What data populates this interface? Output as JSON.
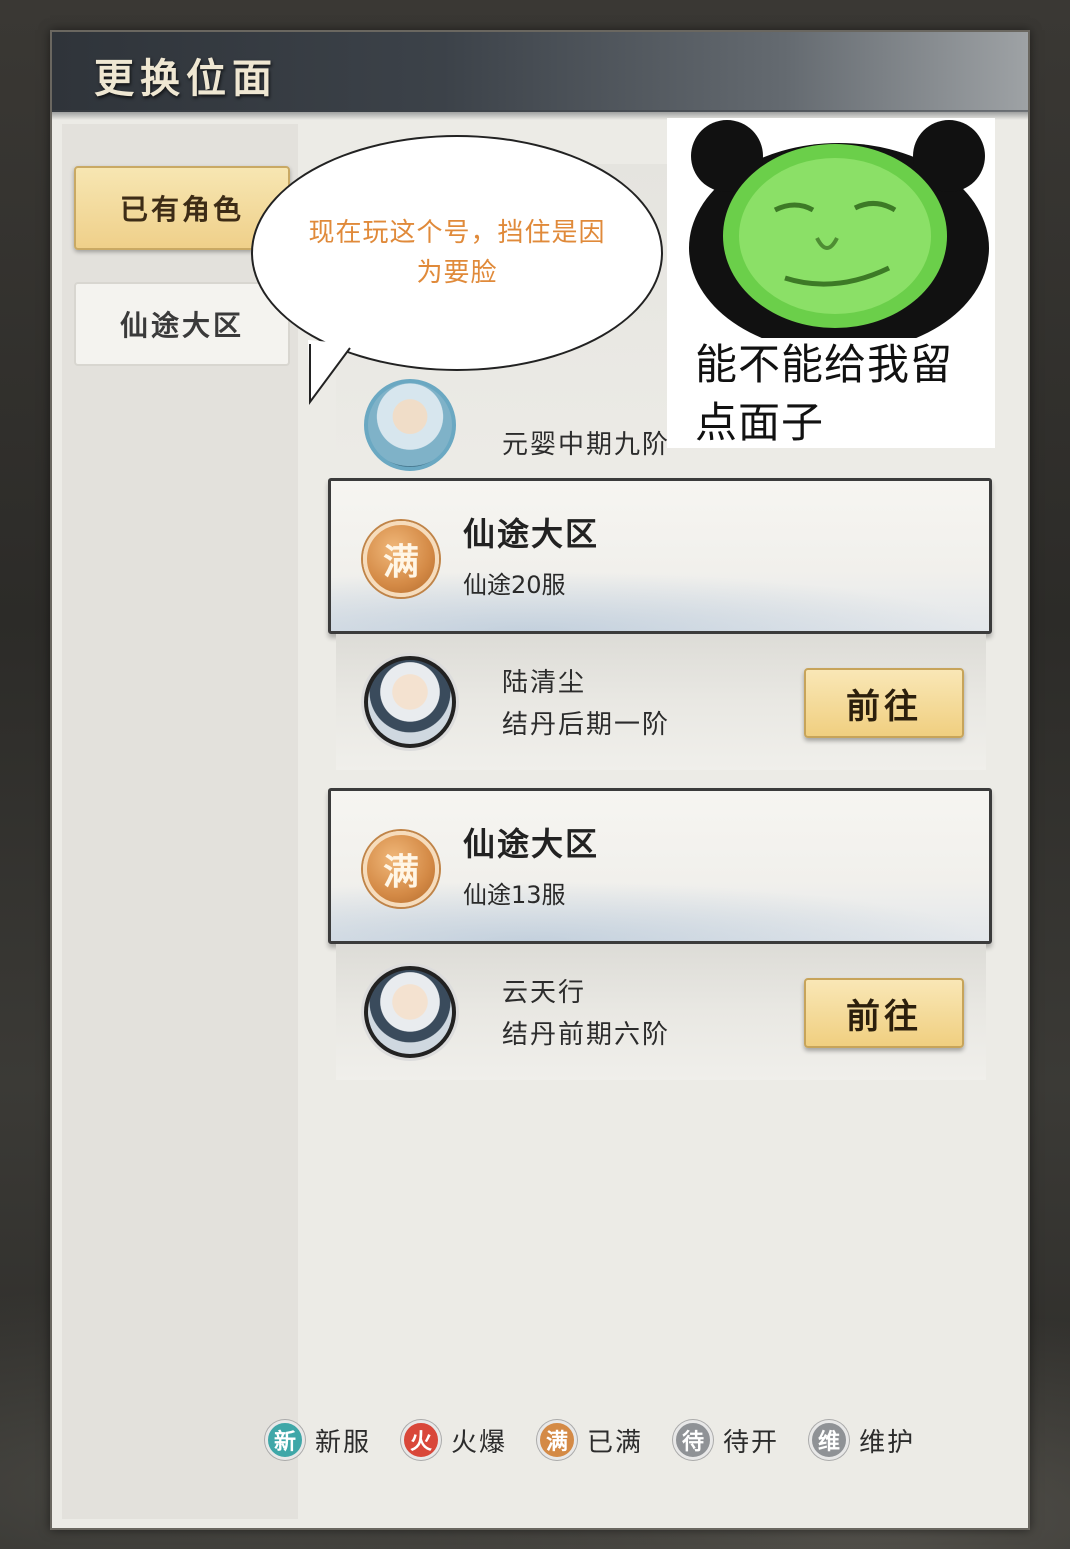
{
  "window": {
    "title": "更换位面"
  },
  "sidebar": {
    "tabs": [
      {
        "label": "已有角色",
        "active": true
      },
      {
        "label": "仙途大区",
        "active": false
      }
    ]
  },
  "partial_entry": {
    "level": "元婴中期九阶"
  },
  "servers": [
    {
      "badge": "满",
      "region": "仙途大区",
      "server": "仙途20服",
      "character": {
        "name": "陆清尘",
        "level": "结丹后期一阶"
      },
      "action_label": "前往"
    },
    {
      "badge": "满",
      "region": "仙途大区",
      "server": "仙途13服",
      "character": {
        "name": "云天行",
        "level": "结丹前期六阶"
      },
      "action_label": "前往"
    }
  ],
  "legend": [
    {
      "glyph": "新",
      "label": "新服",
      "color": "#3fa7a8"
    },
    {
      "glyph": "火",
      "label": "火爆",
      "color": "#d9473a"
    },
    {
      "glyph": "满",
      "label": "已满",
      "color": "#d48a46"
    },
    {
      "glyph": "待",
      "label": "待开",
      "color": "#8f9296"
    },
    {
      "glyph": "维",
      "label": "维护",
      "color": "#8f9296"
    }
  ],
  "overlay": {
    "speech_bubble": "现在玩这个号，挡住是因为要脸",
    "meme_caption": "能不能给我留点面子",
    "meme_icon": "green-panda-face-icon"
  },
  "colors": {
    "accent_gold": "#efd08a",
    "bubble_text": "#e08a3a",
    "header_dark": "#2f343a"
  }
}
